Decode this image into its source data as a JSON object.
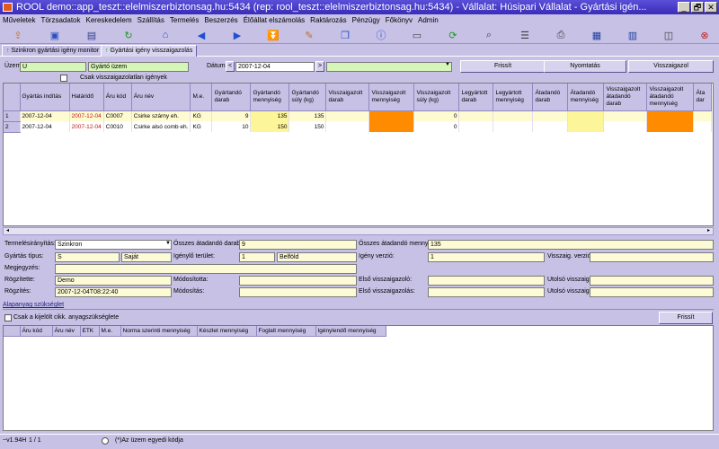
{
  "window": {
    "title": "ROOL demo::app_teszt::elelmiszerbiztonsag.hu:5434 (rep: rool_teszt::elelmiszerbiztonsag.hu:5434) - Vállalat: Húsipari Vállalat - Gyártási igén...",
    "min": "_",
    "max": "🗗",
    "close": "✕"
  },
  "menu": [
    "Műveletek",
    "Törzsadatok",
    "Kereskedelem",
    "Szállítás",
    "Termelés",
    "Beszerzés",
    "Élőállat elszámolás",
    "Raktározás",
    "Pénzügy",
    "Főkönyv",
    "Admin"
  ],
  "toolbar_icons": [
    "open-icon",
    "folder-icon",
    "save-icon",
    "refresh-icon",
    "home-icon",
    "arrow-left-icon",
    "arrow-right-icon",
    "arrow-down-icon",
    "edit-icon",
    "copy-icon",
    "info-icon",
    "form-icon",
    "reload-icon",
    "search-icon",
    "list-icon",
    "print-icon",
    "table-icon",
    "columns-icon",
    "window-icon",
    "close-red-icon"
  ],
  "tabs": [
    "Szinkron gyártási igény monitor",
    "Gyártási igény visszaigazolás"
  ],
  "filter": {
    "uzem_label": "Üzem:",
    "uzem_code": "U",
    "uzem_name": "Gyártó üzem",
    "datum_label": "Dátum:",
    "datum_value": "2007-12-04",
    "datum_prev": "<",
    "datum_next": ">",
    "only_unconfirmed": "Csak visszaigazolatlan igények",
    "btn_refresh": "Frissít",
    "btn_print": "Nyomtatás",
    "btn_confirm": "Visszaigazol"
  },
  "grid": {
    "headers": [
      "Gyártás indítás",
      "Határidő",
      "Áru kód",
      "Áru név",
      "M.e.",
      "Gyártandó darab",
      "Gyártandó mennyiség",
      "Gyártandó súly (kg)",
      "Visszaigazolt darab",
      "Visszaigazolt mennyiség",
      "Visszaigazolt súly (kg)",
      "Legyártott darab",
      "Legyártott mennyiség",
      "Átadandó darab",
      "Átadandó mennyiség",
      "Visszaigazolt átadandó darab",
      "Visszaigazolt átadandó mennyiség",
      "Áta dar"
    ],
    "rows": [
      {
        "n": "1",
        "start": "2007-12-04",
        "deadline": "2007-12-04",
        "code": "C0007",
        "name": "Csirke szárny eh.",
        "unit": "KG",
        "pc": "9",
        "qty": "135",
        "kg": "135",
        "vkg": "0"
      },
      {
        "n": "2",
        "start": "2007-12-04",
        "deadline": "2007-12-04",
        "code": "C0010",
        "name": "Csirke alsó comb eh.",
        "unit": "KG",
        "pc": "10",
        "qty": "150",
        "kg": "150",
        "vkg": "0"
      }
    ]
  },
  "detail": {
    "termeles_label": "Termelésirányítás:",
    "termeles_value": "Szinkron",
    "ossz_darab_label": "Összes átadandó darab:",
    "ossz_darab_value": "9",
    "ossz_menny_label": "Összes átadandó menny.:",
    "ossz_menny_value": "135",
    "gyartas_tipus_label": "Gyártás típus:",
    "gyartas_tipus_code": "S",
    "gyartas_tipus_name": "Saját",
    "igenylo_label": "Igénylő terület:",
    "igenylo_code": "1",
    "igenylo_name": "Belföld",
    "igeny_verzio_label": "Igény verzió:",
    "igeny_verzio_value": "1",
    "vissz_verzio_label": "Visszaig. verzió:",
    "megjegyzes_label": "Megjegyzés:",
    "rogzitette_label": "Rögzítette:",
    "rogzitette_value": "Demo",
    "modositotta_label": "Módosította:",
    "elso_vissz_label": "Első visszaigazoló:",
    "utolso_vissz_label": "Utolsó visszaig.:",
    "rogzites_label": "Rögzítés:",
    "rogzites_value": "2007-12-04T08:22:40",
    "modositas_label": "Módosítás:",
    "elso_vissz2_label": "Első visszaigazolás:",
    "utolso_vissz2_label": "Utolsó visszaig.:"
  },
  "alapanyag": {
    "title": "Alapanyag szükséglet",
    "only_selected": "Csak a kijelölt cikk. anyagszükséglete",
    "btn_refresh": "Frissít",
    "headers": [
      "Áru kód",
      "Áru név",
      "ETK",
      "M.e.",
      "Norma szerinti mennyiség",
      "Készlet mennyiség",
      "Foglalt mennyiség",
      "Igénylendő mennyiség"
    ]
  },
  "status": {
    "version": "~v1.94H",
    "page": "1 / 1",
    "hint": "(*)Az üzem egyedi kódja"
  }
}
